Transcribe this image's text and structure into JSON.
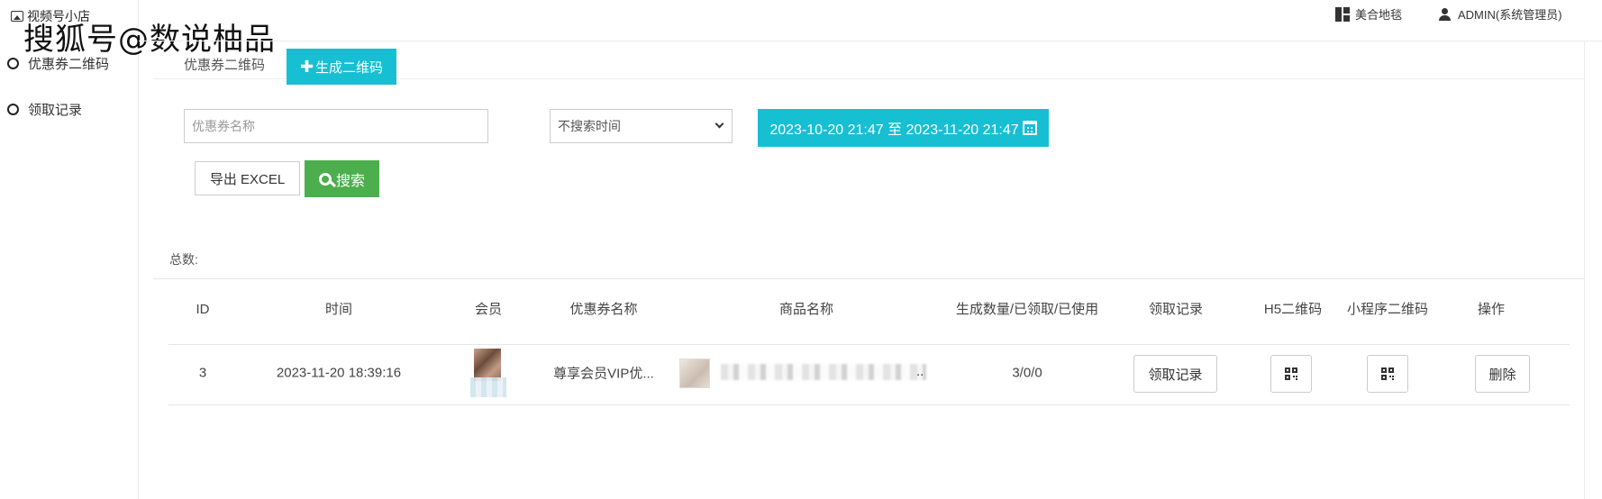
{
  "watermark": "搜狐号@数说柚品",
  "brand": {
    "title": "视频号小店"
  },
  "sidebar": {
    "items": [
      {
        "label": "优惠券二维码"
      },
      {
        "label": "领取记录"
      }
    ]
  },
  "topbar": {
    "store_label": "美合地毯",
    "user_label": "ADMIN(系统管理员)"
  },
  "tab": {
    "label": "优惠券二维码"
  },
  "toolbar": {
    "generate_label": "生成二维码"
  },
  "filters": {
    "name_placeholder": "优惠券名称",
    "time_select_value": "不搜索时间",
    "date_range": "2023-10-20 21:47 至 2023-11-20 21:47",
    "export_label": "导出 EXCEL",
    "search_label": "搜索"
  },
  "summary": {
    "total_label": "总数:"
  },
  "table": {
    "headers": [
      "ID",
      "时间",
      "会员",
      "优惠券名称",
      "商品名称",
      "生成数量/已领取/已使用",
      "领取记录",
      "H5二维码",
      "小程序二维码",
      "操作"
    ],
    "rows": [
      {
        "id": "3",
        "time": "2023-11-20 18:39:16",
        "coupon_name": "尊享会员VIP优...",
        "counts": "3/0/0",
        "record_button": "领取记录",
        "delete_button": "删除"
      }
    ]
  },
  "colors": {
    "accent": "#17bfd3",
    "success": "#4cae4c"
  },
  "icons": [
    "image-icon",
    "dashboard-icon",
    "user-icon",
    "plus-icon",
    "calendar-icon",
    "search-icon",
    "qrcode-icon",
    "chevron-down-icon"
  ]
}
